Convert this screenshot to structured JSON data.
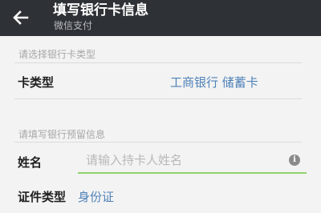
{
  "header": {
    "title": "填写银行卡信息",
    "subtitle": "微信支付"
  },
  "card_section": {
    "header": "请选择银行卡类型",
    "card_type_label": "卡类型",
    "card_type_value": "工商银行 储蓄卡"
  },
  "info_section": {
    "header": "请填写银行预留信息",
    "name_label": "姓名",
    "name_placeholder": "请输入持卡人姓名",
    "name_value": "",
    "id_type_label": "证件类型",
    "id_type_value": "身份证"
  },
  "icons": {
    "back": "back-arrow-icon",
    "info": "info-icon"
  },
  "colors": {
    "topbar": "#2e3135",
    "link": "#4f82b8",
    "input_focus": "#8fd26c"
  }
}
